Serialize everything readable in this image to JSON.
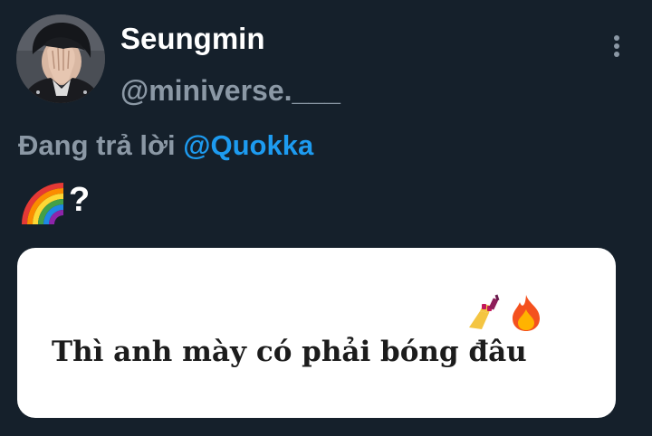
{
  "tweet": {
    "author": {
      "display_name": "Seungmin",
      "handle": "@miniverse.___"
    },
    "reply": {
      "prefix": "Đang trả lời",
      "target": "@Quokka"
    },
    "text": "?",
    "text_emoji": "rainbow-icon",
    "media": {
      "caption": "Thì anh mày có phải bóng đâu",
      "emojis": [
        "nail-polish-icon",
        "fire-icon"
      ]
    }
  },
  "colors": {
    "background": "#15202b",
    "primary_text": "#ffffff",
    "secondary_text": "#8b98a5",
    "accent": "#1d9bf0",
    "card_background": "#ffffff"
  },
  "icons": {
    "more": "more-vertical-icon"
  }
}
